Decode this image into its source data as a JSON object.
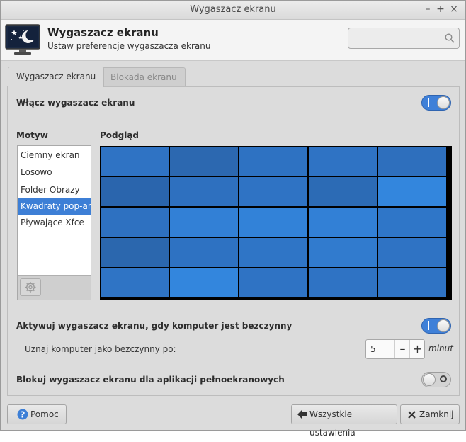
{
  "window": {
    "title": "Wygaszacz ekranu"
  },
  "header": {
    "title": "Wygaszacz ekranu",
    "subtitle": "Ustaw preferencje wygaszacza ekranu",
    "search_placeholder": ""
  },
  "tabs": [
    {
      "label": "Wygaszacz ekranu",
      "active": true
    },
    {
      "label": "Blokada ekranu",
      "active": false
    }
  ],
  "enable": {
    "label": "Włącz wygaszacz ekranu",
    "on": true
  },
  "theme_list": {
    "heading": "Motyw",
    "items": [
      {
        "label": "Ciemny ekran",
        "selected": false
      },
      {
        "label": "Losowo",
        "selected": false
      },
      {
        "label": "Folder Obrazy",
        "selected": false
      },
      {
        "label": "Kwadraty pop-art",
        "selected": true
      },
      {
        "label": "Pływające Xfce",
        "selected": false
      }
    ]
  },
  "preview": {
    "heading": "Podgląd",
    "colors": [
      [
        "#2f73c4",
        "#2c68b0",
        "#2e72c2",
        "#2f73c4",
        "#2e6fbd"
      ],
      [
        "#2a65ad",
        "#2e70bf",
        "#2f73c4",
        "#2c6bb5",
        "#3386dd"
      ],
      [
        "#2e71c1",
        "#3280d6",
        "#3282d8",
        "#3280d6",
        "#2f76c8"
      ],
      [
        "#2b67ae",
        "#2e72c2",
        "#2f75c6",
        "#317bce",
        "#2f73c4"
      ],
      [
        "#2f74c5",
        "#3386dd",
        "#2f73c4",
        "#2f73c4",
        "#2f73c4"
      ]
    ]
  },
  "activate": {
    "label": "Aktywuj wygaszacz ekranu, gdy komputer jest bezczynny",
    "on": true
  },
  "idle": {
    "label": "Uznaj komputer jako bezczynny po:",
    "value": "5",
    "unit": "minut"
  },
  "fullscreen": {
    "label": "Blokuj wygaszacz ekranu dla aplikacji pełnoekranowych",
    "on": false
  },
  "footer": {
    "help_label": "Pomoc",
    "all_settings_label": "Wszystkie ustawienia",
    "close_label": "Zamknij"
  }
}
